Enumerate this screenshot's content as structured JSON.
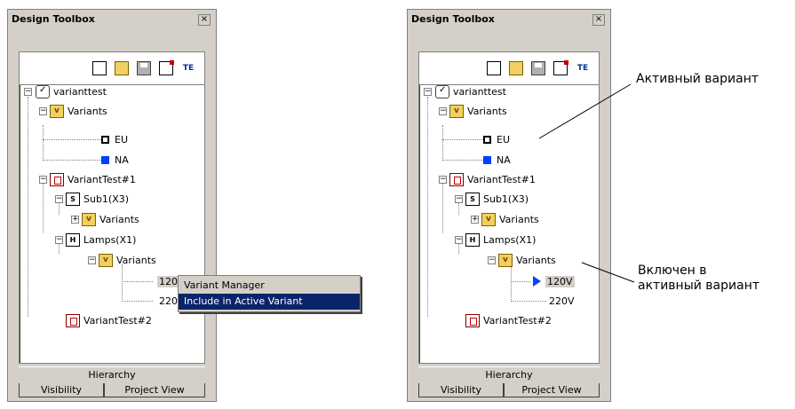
{
  "panel_title": "Design Toolbox",
  "close_glyph": "×",
  "toolbar_icons": [
    "new-icon",
    "open-folder-icon",
    "save-icon",
    "properties-icon",
    "te-icon"
  ],
  "te_text": "TE",
  "tree": {
    "root": "varianttest",
    "variants_folder": "Variants",
    "eu": "EU",
    "na": "NA",
    "variant_test_1": "VariantTest#1",
    "sub1": "Sub1(X3)",
    "sub_variants": "Variants",
    "lamps": "Lamps(X1)",
    "lamps_variants": "Variants",
    "v120": "120V",
    "v220": "220V",
    "variant_test_2": "VariantTest#2"
  },
  "tabs": {
    "hierarchy": "Hierarchy",
    "visibility": "Visibility",
    "project_view": "Project View"
  },
  "context_menu": {
    "item1": "Variant Manager",
    "item2": "Include in Active Variant"
  },
  "annotations": {
    "active_variant": "Активный вариант",
    "included_line1": "Включен в",
    "included_line2": "активный вариант"
  },
  "colors": {
    "panel_bg": "#d4d0c8",
    "menu_highlight": "#0a246a",
    "active_variant_blue": "#0040ff",
    "pointer_blue": "#1040ff"
  }
}
